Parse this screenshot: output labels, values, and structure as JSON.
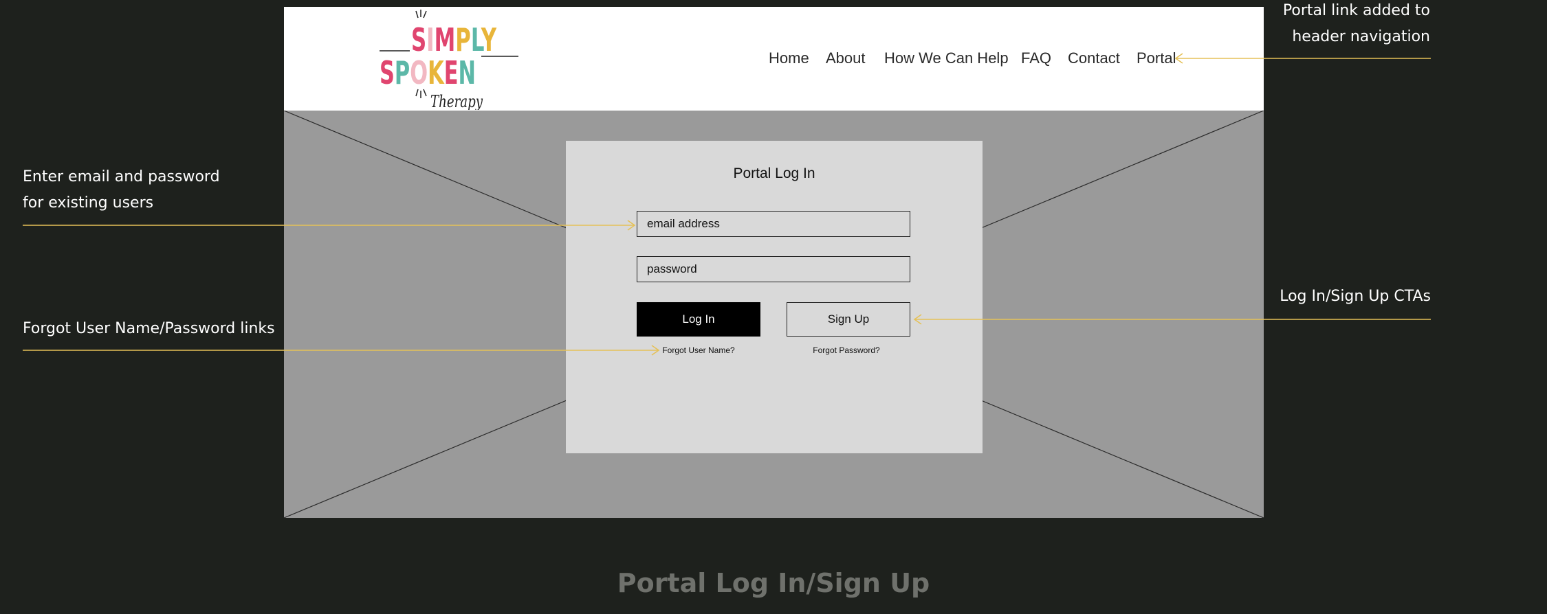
{
  "header": {
    "logo": {
      "line1": "SIMPLY",
      "line2": "SPOKEN",
      "line3": "Therapy",
      "colors": [
        "#e0456f",
        "#f2b8c2",
        "#e8b53a",
        "#5cb8a8",
        "#e0456f",
        "#f2b8c2"
      ]
    },
    "nav": [
      {
        "label": "Home"
      },
      {
        "label": "About"
      },
      {
        "label": "How We Can Help"
      },
      {
        "label": "FAQ"
      },
      {
        "label": "Contact"
      },
      {
        "label": "Portal"
      }
    ]
  },
  "login_card": {
    "title": "Portal Log In",
    "email_placeholder": "email address",
    "password_placeholder": "password",
    "login_label": "Log In",
    "signup_label": "Sign Up",
    "forgot_username": "Forgot User Name?",
    "forgot_password": "Forgot Password?"
  },
  "annotations": {
    "portal_link": [
      "Portal link added to",
      "header navigation"
    ],
    "email_password": [
      "Enter email and password",
      "for existing users"
    ],
    "forgot_links": [
      "Forgot User Name/Password links"
    ],
    "ctas": [
      "Log In/Sign Up CTAs"
    ]
  },
  "footer": {
    "title": "Portal Log In/Sign Up"
  },
  "colors": {
    "background": "#1e211d",
    "arrow": "#e5c158",
    "placeholder_image": "#9a9a9a",
    "card": "#d9d9d9"
  }
}
